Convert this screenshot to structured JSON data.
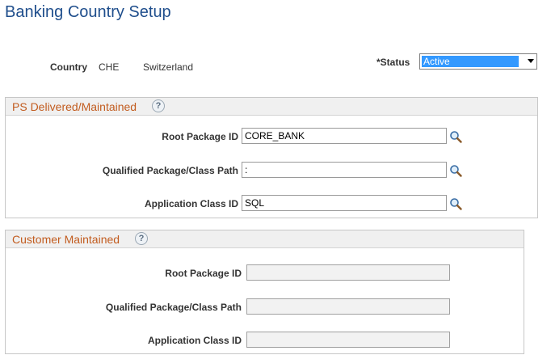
{
  "page": {
    "title": "Banking Country Setup"
  },
  "country": {
    "label": "Country",
    "code": "CHE",
    "name": "Switzerland"
  },
  "status": {
    "label": "*Status",
    "value": "Active"
  },
  "ps_delivered": {
    "title": "PS Delivered/Maintained",
    "help": "?",
    "fields": [
      {
        "label": "Root Package ID",
        "value": "CORE_BANK"
      },
      {
        "label": "Qualified Package/Class Path",
        "value": ":"
      },
      {
        "label": "Application Class ID",
        "value": "SQL"
      }
    ]
  },
  "customer": {
    "title": "Customer Maintained",
    "help": "?",
    "fields": [
      {
        "label": "Root Package ID",
        "value": ""
      },
      {
        "label": "Qualified Package/Class Path",
        "value": ""
      },
      {
        "label": "Application Class ID",
        "value": ""
      }
    ]
  },
  "colors": {
    "title": "#1f4e8c",
    "group_title": "#c25c1f",
    "selection": "#3399ff"
  },
  "icons": {
    "lookup": "magnifier-icon",
    "help": "help-icon",
    "dropdown": "chevron-down-icon"
  }
}
